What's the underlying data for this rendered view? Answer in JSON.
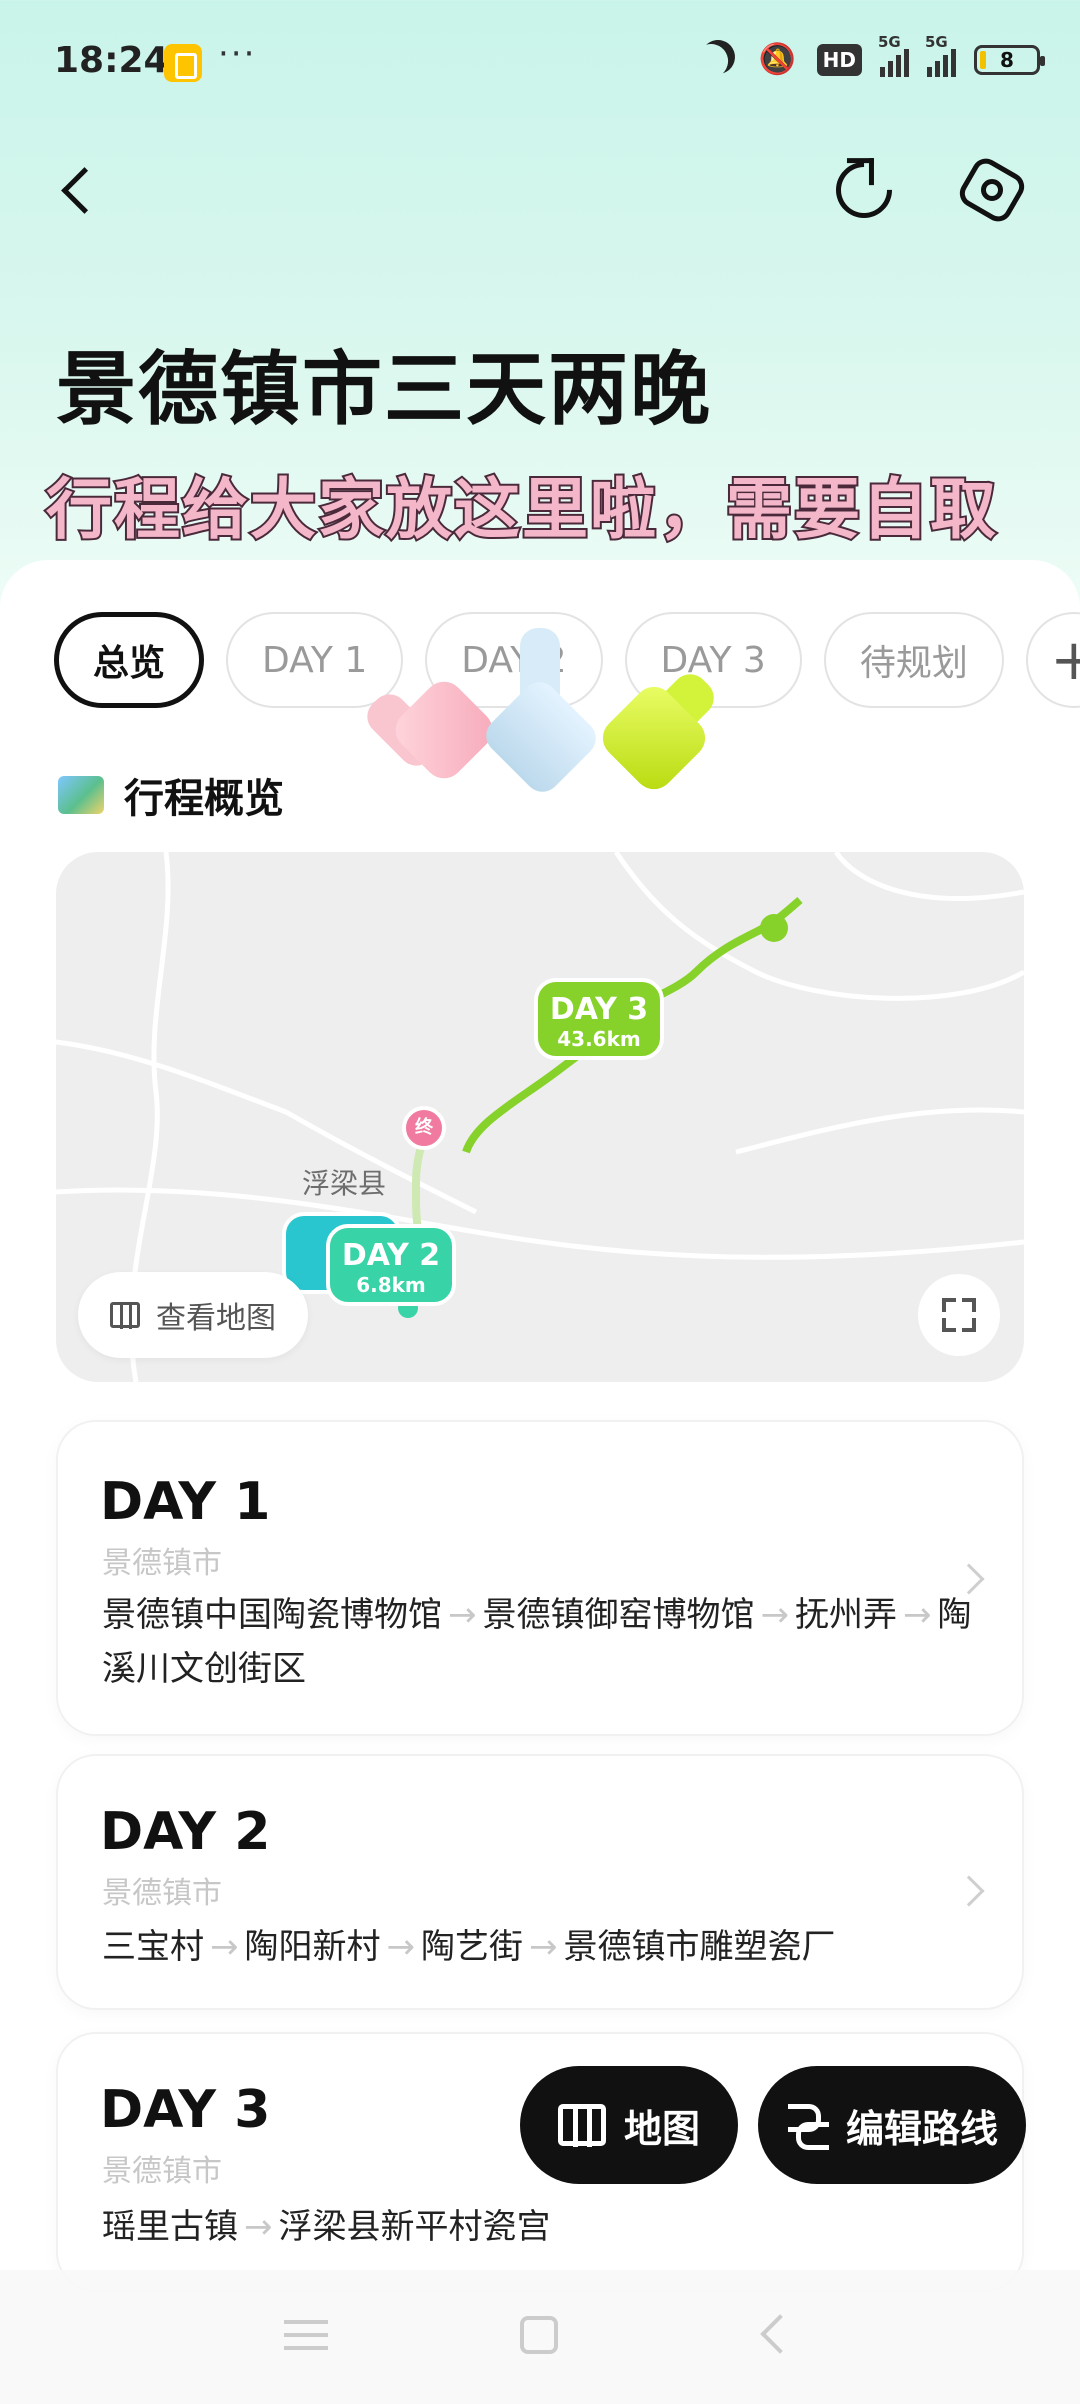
{
  "status_bar": {
    "time": "18:24",
    "more": "···",
    "hd_badge": "HD",
    "signal1_label": "5G",
    "signal2_label": "5G",
    "battery": "8"
  },
  "header": {
    "title": "景德镇市三天两晚",
    "banner": "行程给大家放这里啦，需要自取"
  },
  "tabs": [
    {
      "label": "总览",
      "active": true
    },
    {
      "label": "DAY 1"
    },
    {
      "label": "DAY 2"
    },
    {
      "label": "DAY 3"
    },
    {
      "label": "待规划"
    },
    {
      "label": "+"
    }
  ],
  "overview": {
    "section_title": "行程概览"
  },
  "map": {
    "day3_label": "DAY 3",
    "day3_km": "43.6km",
    "day2_label": "DAY 2",
    "day2_km": "6.8km",
    "day1_label": "D",
    "day1_km": "8",
    "end_marker": "终",
    "town": "浮梁县",
    "view_map_label": "查看地图",
    "colors": {
      "day1": "#29c6cf",
      "day2": "#38d3a6",
      "day3": "#86d22a",
      "end": "#f07aa0"
    }
  },
  "days": [
    {
      "title": "DAY 1",
      "city": "景德镇市",
      "stops": [
        "景德镇中国陶瓷博物馆",
        "景德镇御窑博物馆",
        "抚州弄",
        "陶溪川文创街区"
      ]
    },
    {
      "title": "DAY 2",
      "city": "景德镇市",
      "stops": [
        "三宝村",
        "陶阳新村",
        "陶艺街",
        "景德镇市雕塑瓷厂"
      ]
    },
    {
      "title": "DAY 3",
      "city": "景德镇市",
      "stops": [
        "瑶里古镇",
        "浮梁县新平村瓷宫"
      ]
    }
  ],
  "actions": {
    "map_button": "地图",
    "edit_route_button": "编辑路线"
  },
  "icons": {
    "back": "chevron-left-icon",
    "share": "share-icon",
    "settings": "settings-icon",
    "map": "folded-map-icon",
    "route": "route-icon",
    "fullscreen": "fullscreen-icon"
  }
}
